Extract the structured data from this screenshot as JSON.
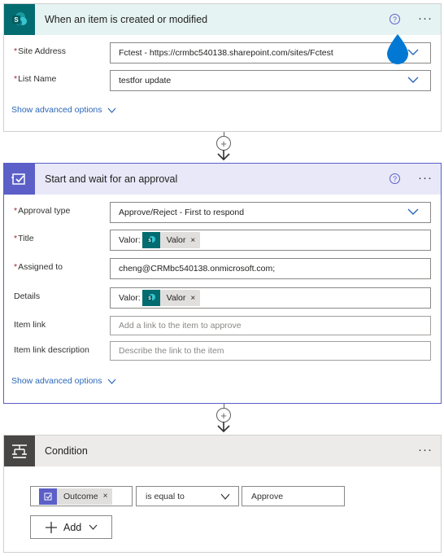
{
  "trigger": {
    "title": "When an item is created or modified",
    "help_glyph": "?",
    "more_glyph": "···",
    "site_address_label": "Site Address",
    "site_address_value": "Fctest - https://crmbc540138.sharepoint.com/sites/Fctest",
    "list_name_label": "List Name",
    "list_name_value": "testfor update",
    "show_advanced": "Show advanced options",
    "required_marker": "*",
    "brand_color": "#036c70"
  },
  "approval": {
    "title": "Start and wait for an approval",
    "help_glyph": "?",
    "more_glyph": "···",
    "approval_type_label": "Approval type",
    "approval_type_value": "Approve/Reject - First to respond",
    "title_label": "Title",
    "title_prefix": "Valor:",
    "title_token": "Valor",
    "assigned_label": "Assigned to",
    "assigned_value": "cheng@CRMbc540138.onmicrosoft.com;",
    "details_label": "Details",
    "details_prefix": "Valor:",
    "details_token": "Valor",
    "item_link_label": "Item link",
    "item_link_placeholder": "Add a link to the item to approve",
    "item_link_desc_label": "Item link description",
    "item_link_desc_placeholder": "Describe the link to the item",
    "show_advanced": "Show advanced options",
    "required_marker": "*",
    "accent_color": "#5b5fc7",
    "header_bg": "#e8e8f8"
  },
  "condition": {
    "title": "Condition",
    "more_glyph": "···",
    "left_token": "Outcome",
    "operator": "is equal to",
    "right_value": "Approve",
    "add_label": "Add",
    "header_bg": "#edebe9",
    "icon_bg": "#484644"
  },
  "connector": {
    "plus_glyph": "+"
  },
  "token_remove_glyph": "×"
}
